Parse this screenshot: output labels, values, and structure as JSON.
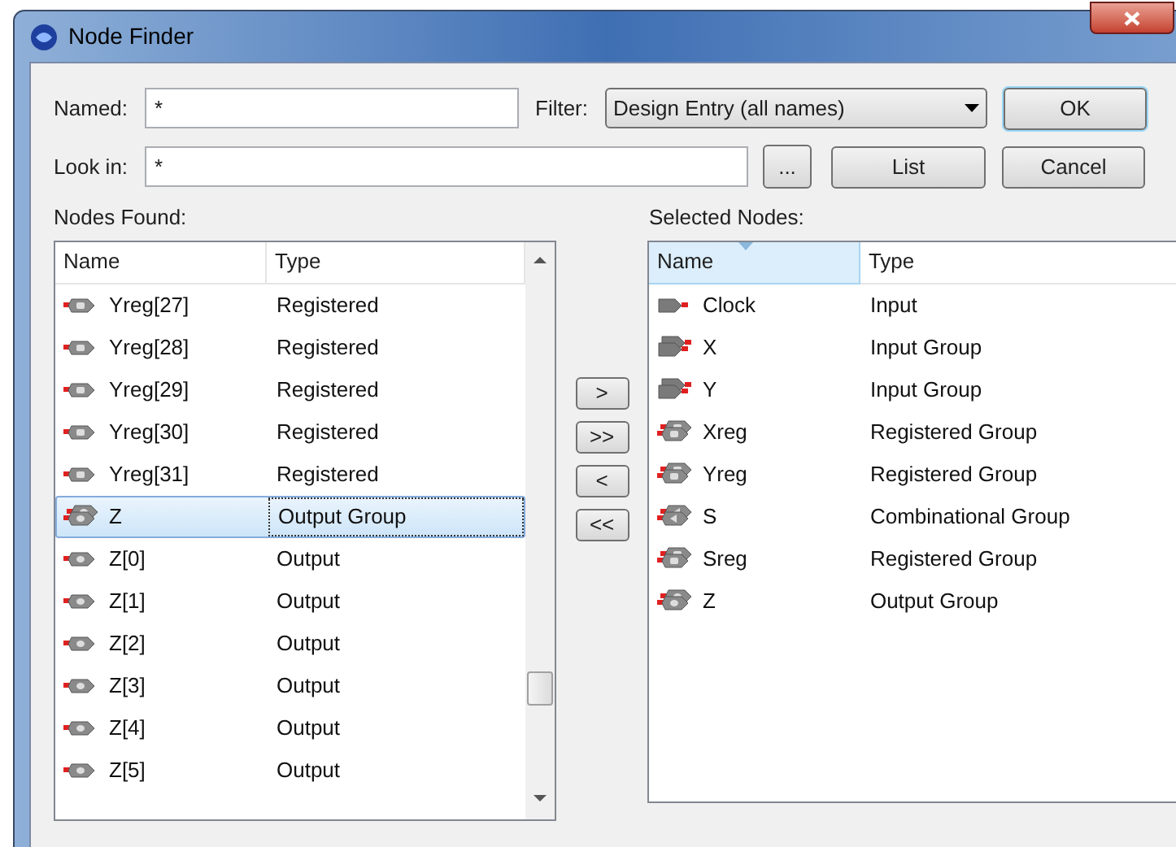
{
  "window": {
    "title": "Node Finder"
  },
  "named": {
    "label": "Named:",
    "value": "*"
  },
  "filter": {
    "label": "Filter:",
    "value": "Design Entry (all names)"
  },
  "look_in": {
    "label": "Look in:",
    "value": "*"
  },
  "buttons": {
    "ok": "OK",
    "browse": "...",
    "list": "List",
    "cancel": "Cancel"
  },
  "nodes_found": {
    "label": "Nodes Found:",
    "columns": [
      {
        "label": "Name",
        "sorted": false
      },
      {
        "label": "Type",
        "sorted": false
      }
    ],
    "rows": [
      {
        "name": "Yreg[27]",
        "type": "Registered",
        "kind": "registered",
        "group": false,
        "selected": false
      },
      {
        "name": "Yreg[28]",
        "type": "Registered",
        "kind": "registered",
        "group": false,
        "selected": false
      },
      {
        "name": "Yreg[29]",
        "type": "Registered",
        "kind": "registered",
        "group": false,
        "selected": false
      },
      {
        "name": "Yreg[30]",
        "type": "Registered",
        "kind": "registered",
        "group": false,
        "selected": false
      },
      {
        "name": "Yreg[31]",
        "type": "Registered",
        "kind": "registered",
        "group": false,
        "selected": false
      },
      {
        "name": "Z",
        "type": "Output Group",
        "kind": "output",
        "group": true,
        "selected": true
      },
      {
        "name": "Z[0]",
        "type": "Output",
        "kind": "output",
        "group": false,
        "selected": false
      },
      {
        "name": "Z[1]",
        "type": "Output",
        "kind": "output",
        "group": false,
        "selected": false
      },
      {
        "name": "Z[2]",
        "type": "Output",
        "kind": "output",
        "group": false,
        "selected": false
      },
      {
        "name": "Z[3]",
        "type": "Output",
        "kind": "output",
        "group": false,
        "selected": false
      },
      {
        "name": "Z[4]",
        "type": "Output",
        "kind": "output",
        "group": false,
        "selected": false
      },
      {
        "name": "Z[5]",
        "type": "Output",
        "kind": "output",
        "group": false,
        "selected": false
      }
    ]
  },
  "move_buttons": [
    ">",
    ">>",
    "<",
    "<<"
  ],
  "selected_nodes": {
    "label": "Selected Nodes:",
    "columns": [
      {
        "label": "Name",
        "sorted": true
      },
      {
        "label": "Type",
        "sorted": false
      }
    ],
    "rows": [
      {
        "name": "Clock",
        "type": "Input",
        "kind": "input",
        "group": false,
        "selected": false
      },
      {
        "name": "X",
        "type": "Input Group",
        "kind": "input",
        "group": true,
        "selected": false
      },
      {
        "name": "Y",
        "type": "Input Group",
        "kind": "input",
        "group": true,
        "selected": false
      },
      {
        "name": "Xreg",
        "type": "Registered Group",
        "kind": "registered",
        "group": true,
        "selected": false
      },
      {
        "name": "Yreg",
        "type": "Registered Group",
        "kind": "registered",
        "group": true,
        "selected": false
      },
      {
        "name": "S",
        "type": "Combinational Group",
        "kind": "combinational",
        "group": true,
        "selected": false
      },
      {
        "name": "Sreg",
        "type": "Registered Group",
        "kind": "registered",
        "group": true,
        "selected": false
      },
      {
        "name": "Z",
        "type": "Output Group",
        "kind": "output",
        "group": true,
        "selected": false
      }
    ]
  }
}
